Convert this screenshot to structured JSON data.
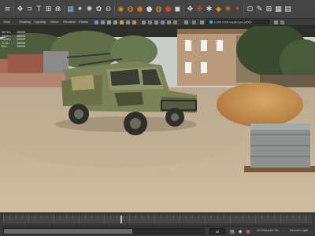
{
  "shelf": {
    "icons": [
      {
        "name": "menu-set-icon",
        "glyph": "≡",
        "color": "#d8d8d8"
      },
      {
        "name": "select-tool-icon",
        "glyph": "✥",
        "color": "#e0e0e0"
      },
      {
        "name": "lasso-tool-icon",
        "glyph": "⊃",
        "color": "#e0e0e0"
      },
      {
        "name": "paint-select-icon",
        "glyph": "T",
        "color": "#e0e0e0"
      },
      {
        "name": "snap-grid-icon",
        "glyph": "⊞",
        "color": "#e0e0e0"
      },
      {
        "name": "snap-curve-icon",
        "glyph": "⋒",
        "color": "#e0e0e0"
      },
      {
        "name": "display-grid-icon",
        "glyph": "▦",
        "color": "#7fb5d9"
      },
      {
        "name": "snap-point-icon",
        "glyph": "⁕",
        "color": "#cfcfcf"
      },
      {
        "name": "snap-view-icon",
        "glyph": "✺",
        "color": "#cfcfcf"
      },
      {
        "name": "snap-surface-icon",
        "glyph": "✿",
        "color": "#cfcfcf"
      },
      {
        "name": "history-icon",
        "glyph": "⊖",
        "color": "#cfcfcf"
      },
      {
        "name": "render-frame-icon",
        "glyph": "◉",
        "color": "#e08a2a"
      },
      {
        "name": "render-ipr-icon",
        "glyph": "◍",
        "color": "#e08a2a"
      },
      {
        "name": "render-settings-icon",
        "glyph": "●",
        "color": "#d06a2a"
      },
      {
        "name": "hypershade-icon",
        "glyph": "●",
        "color": "#d0d0d0"
      },
      {
        "name": "light-editor-icon",
        "glyph": "◍",
        "color": "#e4a02a"
      },
      {
        "name": "arnold-render-icon",
        "glyph": "●",
        "color": "#d04a2a"
      },
      {
        "name": "ui-toggle-icon",
        "glyph": "◼",
        "color": "#cfcfcf"
      },
      {
        "name": "move-tool-icon",
        "glyph": "✥",
        "color": "#e0e0e0"
      },
      {
        "name": "camera-select-icon",
        "glyph": "✤",
        "color": "#d04a2a"
      },
      {
        "name": "camera-settings-icon",
        "glyph": "✱",
        "color": "#d0d0d0"
      },
      {
        "name": "camera-attributes-icon",
        "glyph": "◆",
        "color": "#e08a2a"
      },
      {
        "name": "image-plane-icon",
        "glyph": "✺",
        "color": "#d06a2a"
      },
      {
        "name": "bookmark-icon",
        "glyph": "✦",
        "color": "#d04a2a"
      },
      {
        "name": "grease-pencil-icon",
        "glyph": "⊡",
        "color": "#d0d0d0"
      },
      {
        "name": "two-d-pan-icon",
        "glyph": "✎",
        "color": "#e0e0e0"
      },
      {
        "name": "wireframe-icon",
        "glyph": "⊞",
        "color": "#e0e0e0"
      },
      {
        "name": "grid-toggle-icon",
        "glyph": "▦",
        "color": "#e0e0e0"
      },
      {
        "name": "sidebar-toggle-icon",
        "glyph": "▤",
        "color": "#e0e0e0"
      }
    ]
  },
  "panel": {
    "menus": [
      "View",
      "Shading",
      "Lighting",
      "Show",
      "Renderer",
      "Panels"
    ],
    "field_text": "0.000 0.000 mastercam.p0000"
  },
  "hud": {
    "rows": [
      {
        "label": "Verts:",
        "value": "84645"
      },
      {
        "label": "Edges:",
        "value": "84645"
      },
      {
        "label": "Faces:",
        "value": "84645"
      },
      {
        "label": "Tris:",
        "value": "84645"
      },
      {
        "label": "UVs:",
        "value": "84645"
      }
    ]
  },
  "timeline": {
    "playhead_fraction": 0.38
  },
  "range": {
    "fill_fraction": 0.64,
    "current_frame": "30",
    "char_set_label": "No Character Set",
    "anim_layer_label": "No Anim Layer"
  },
  "colors": {
    "accent": "#4aa3df",
    "shelf_bg": "#444444",
    "panel_bg": "#3c3c3c"
  }
}
